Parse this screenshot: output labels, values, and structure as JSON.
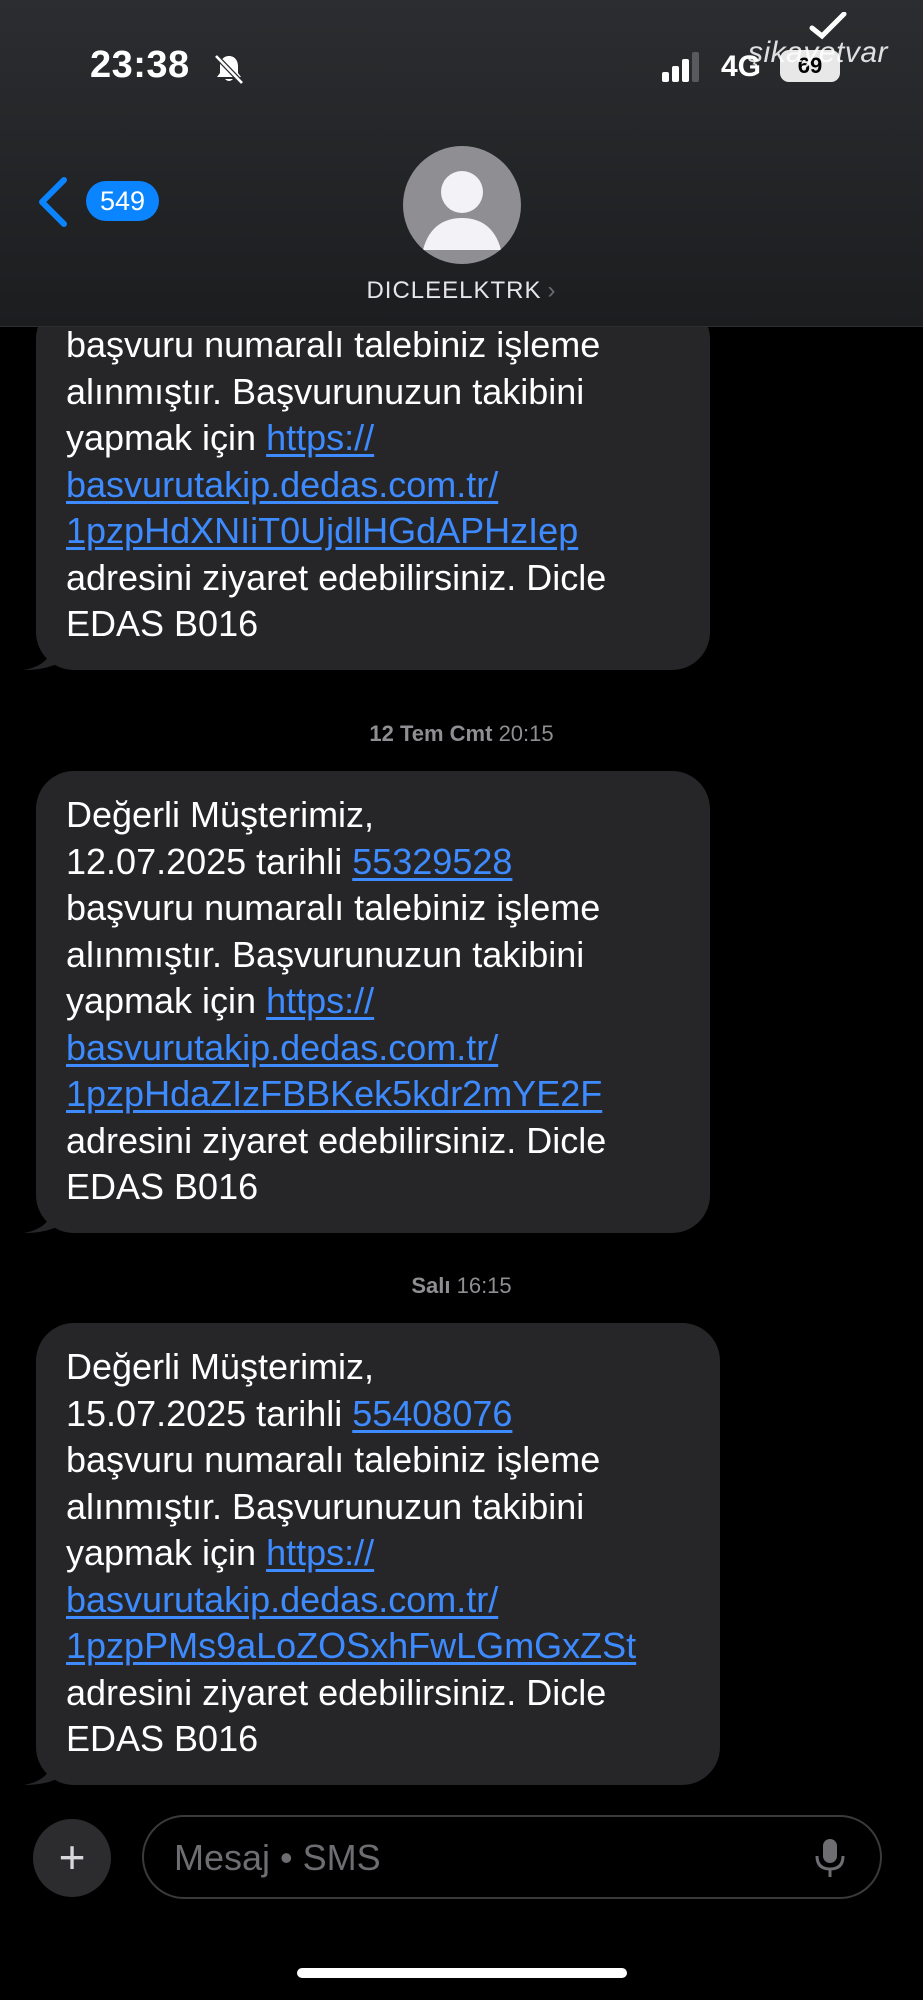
{
  "status_bar": {
    "time": "23:38",
    "network": "4G",
    "battery": "69",
    "watermark": "şikayetvar"
  },
  "nav": {
    "back_count": "549",
    "contact_name": "DICLEELKTRK",
    "contact_chevron": "›"
  },
  "messages": [
    {
      "lines": [
        {
          "text": "başvuru numaralı talebiniz işleme"
        },
        {
          "text": "alınmıştır. Başvurunuzun takibini"
        },
        {
          "pre": "yapmak için ",
          "link": "https://"
        },
        {
          "link": "basvurutakip.dedas.com.tr/"
        },
        {
          "link": "1pzpHdXNIiT0UjdlHGdAPHzIep"
        },
        {
          "text": "adresini ziyaret edebilirsiniz. Dicle"
        },
        {
          "text": "EDAS B016"
        }
      ]
    },
    {
      "lines": [
        {
          "text": "Değerli Müşterimiz,"
        },
        {
          "pre": "12.07.2025 tarihli ",
          "link": "55329528"
        },
        {
          "text": "başvuru numaralı talebiniz işleme"
        },
        {
          "text": "alınmıştır. Başvurunuzun takibini"
        },
        {
          "pre": "yapmak için ",
          "link": "https://"
        },
        {
          "link": "basvurutakip.dedas.com.tr/"
        },
        {
          "link": "1pzpHdaZIzFBBKek5kdr2mYE2F"
        },
        {
          "text": "adresini ziyaret edebilirsiniz. Dicle"
        },
        {
          "text": "EDAS B016"
        }
      ]
    },
    {
      "lines": [
        {
          "text": "Değerli Müşterimiz,"
        },
        {
          "pre": "15.07.2025 tarihli ",
          "link": "55408076"
        },
        {
          "text": "başvuru numaralı talebiniz işleme"
        },
        {
          "text": "alınmıştır. Başvurunuzun takibini"
        },
        {
          "pre": "yapmak için ",
          "link": "https://"
        },
        {
          "link": "basvurutakip.dedas.com.tr/"
        },
        {
          "link": "1pzpPMs9aLoZOSxhFwLGmGxZSt"
        },
        {
          "text": "adresini ziyaret edebilirsiniz. Dicle"
        },
        {
          "text": "EDAS B016"
        }
      ]
    }
  ],
  "timestamps": [
    {
      "day": "12 Tem Cmt",
      "time": "20:15"
    },
    {
      "day": "Salı",
      "time": "16:15"
    }
  ],
  "composer": {
    "placeholder": "Mesaj • SMS",
    "plus": "+"
  },
  "icons": {
    "bell": "bell-slash-icon",
    "signal": "signal-bars-icon",
    "back": "chevron-left-icon",
    "avatar": "person-silhouette-icon",
    "mic": "microphone-icon",
    "plus": "plus-icon"
  },
  "colors": {
    "accent": "#0a84ff",
    "link": "#3d8bff",
    "bubble": "#262629",
    "background": "#000000"
  }
}
